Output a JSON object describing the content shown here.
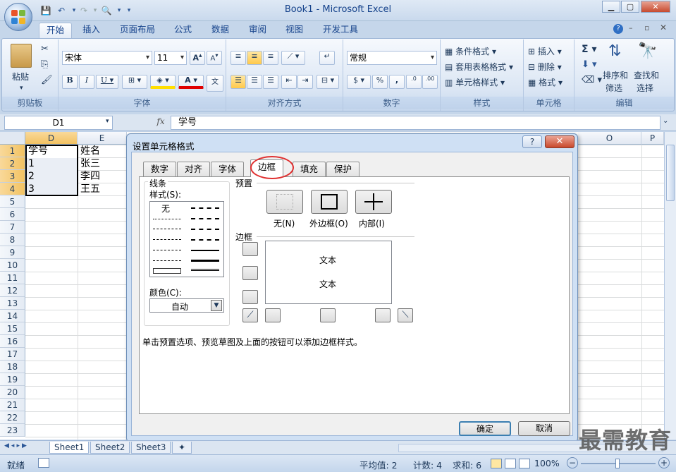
{
  "app": {
    "title": "Book1 - Microsoft Excel"
  },
  "ribbon_tabs": [
    "开始",
    "插入",
    "页面布局",
    "公式",
    "数据",
    "审阅",
    "视图",
    "开发工具"
  ],
  "ribbon": {
    "clipboard": {
      "paste": "粘贴",
      "label": "剪贴板"
    },
    "font": {
      "name": "宋体",
      "size": "11",
      "label": "字体"
    },
    "alignment": {
      "label": "对齐方式"
    },
    "number": {
      "format": "常规",
      "label": "数字"
    },
    "styles": {
      "cond": "条件格式",
      "table": "套用表格格式",
      "cell": "单元格样式",
      "label": "样式"
    },
    "cells": {
      "insert": "插入",
      "delete": "删除",
      "format": "格式",
      "label": "单元格"
    },
    "editing": {
      "sort1": "排序和",
      "sort2": "筛选",
      "find1": "查找和",
      "find2": "选择",
      "label": "编辑"
    }
  },
  "formula_bar": {
    "name_box": "D1",
    "fx": "fx",
    "value": "学号"
  },
  "sheet": {
    "columns": [
      "D",
      "E",
      "O",
      "P"
    ],
    "rows": [
      "1",
      "2",
      "3",
      "4",
      "5",
      "6",
      "7",
      "8",
      "9",
      "10",
      "11",
      "12",
      "13",
      "14",
      "15",
      "16",
      "17",
      "18",
      "19",
      "20",
      "21",
      "22",
      "23"
    ],
    "cells_d": [
      "学号",
      "1",
      "2",
      "3"
    ],
    "cells_e": [
      "姓名",
      "张三",
      "李四",
      "王五"
    ]
  },
  "sheet_tabs": [
    "Sheet1",
    "Sheet2",
    "Sheet3"
  ],
  "status": {
    "ready": "就绪",
    "avg": "平均值: 2",
    "count": "计数: 4",
    "sum": "求和: 6",
    "zoom": "100%"
  },
  "dialog": {
    "title": "设置单元格格式",
    "tabs": [
      "数字",
      "对齐",
      "字体",
      "边框",
      "填充",
      "保护"
    ],
    "line_group": "线条",
    "style_label": "样式(S):",
    "style_none": "无",
    "color_label": "颜色(C):",
    "color_value": "自动",
    "presets_label": "预置",
    "preset_none": "无(N)",
    "preset_outline": "外边框(O)",
    "preset_inside": "内部(I)",
    "border_label": "边框",
    "preview_text_1": "文本",
    "preview_text_2": "文本",
    "hint": "单击预置选项、预览草图及上面的按钮可以添加边框样式。",
    "ok": "确定",
    "cancel": "取消"
  },
  "watermark": "最需教育"
}
